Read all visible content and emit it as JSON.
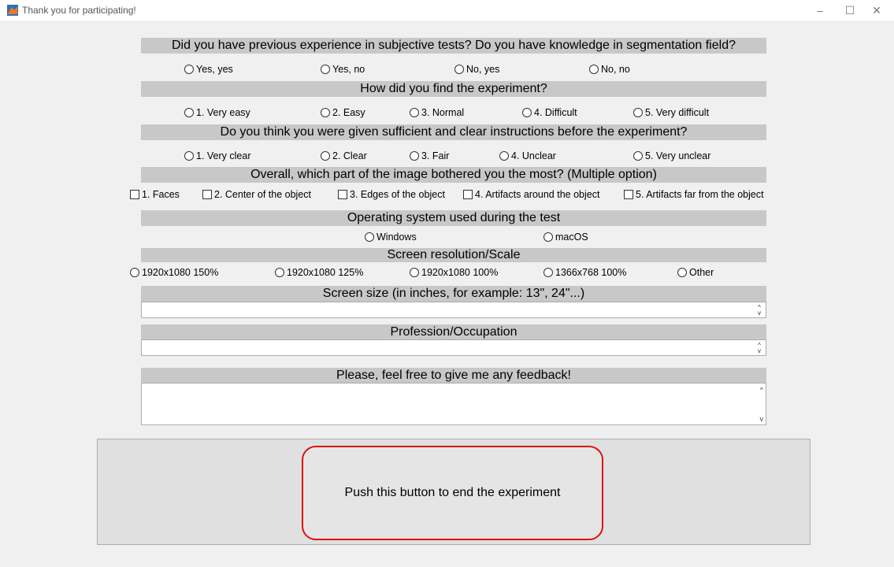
{
  "window": {
    "title": "Thank you for participating!",
    "icon": "matlab-icon",
    "controls": {
      "minimize": "–",
      "maximize": "☐",
      "close": "✕"
    }
  },
  "q1": {
    "question": "Did you have previous experience in subjective tests? Do you have knowledge in segmentation field?",
    "options": [
      "Yes, yes",
      "Yes, no",
      "No, yes",
      "No, no"
    ]
  },
  "q2": {
    "question": "How did you find the experiment?",
    "options": [
      "1. Very easy",
      "2. Easy",
      "3. Normal",
      "4. Difficult",
      "5. Very difficult"
    ]
  },
  "q3": {
    "question": "Do you think you were given sufficient and clear instructions before the experiment?",
    "options": [
      "1. Very clear",
      "2. Clear",
      "3. Fair",
      "4. Unclear",
      "5. Very unclear"
    ]
  },
  "q4": {
    "question": "Overall, which part of the image bothered you the most? (Multiple option)",
    "options": [
      "1. Faces",
      "2. Center of the object",
      "3. Edges of the object",
      "4. Artifacts around the object",
      "5. Artifacts far from the object"
    ]
  },
  "q5": {
    "question": "Operating system used during the test",
    "options": [
      "Windows",
      "macOS"
    ]
  },
  "q6": {
    "question": "Screen resolution/Scale",
    "options": [
      "1920x1080 150%",
      "1920x1080 125%",
      "1920x1080 100%",
      "1366x768 100%",
      "Other"
    ]
  },
  "q7": {
    "question": "Screen size (in inches, for example: 13\", 24\"...)",
    "value": ""
  },
  "q8": {
    "question": "Profession/Occupation",
    "value": ""
  },
  "q9": {
    "question": "Please, feel free to give me any feedback!",
    "value": ""
  },
  "end_button": {
    "label": "Push this button to end the experiment"
  },
  "colors": {
    "header_bg": "#c8c8c8",
    "window_bg": "#f0f0f0",
    "button_border": "#e01010"
  }
}
